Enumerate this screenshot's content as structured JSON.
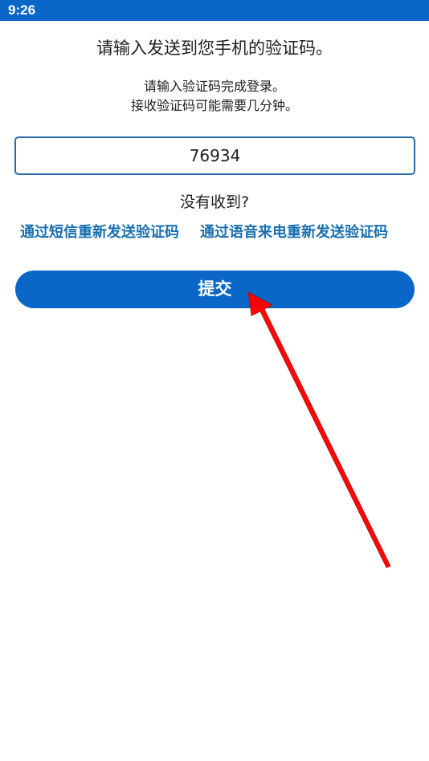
{
  "status_bar": {
    "time": "9:26"
  },
  "header": {
    "title": "请输入发送到您手机的验证码。",
    "subtitle_line1": "请输入验证码完成登录。",
    "subtitle_line2": "接收验证码可能需要几分钟。"
  },
  "form": {
    "code_value": "76934",
    "not_received_label": "没有收到?",
    "resend_sms_label": "通过短信重新发送验证码",
    "resend_voice_label": "通过语音来电重新发送验证码",
    "submit_label": "提交"
  },
  "colors": {
    "primary": "#0a67c8",
    "link": "#1a6fb0",
    "arrow": "#ff0000"
  },
  "icons": {
    "annotation": "red-arrow-icon"
  }
}
